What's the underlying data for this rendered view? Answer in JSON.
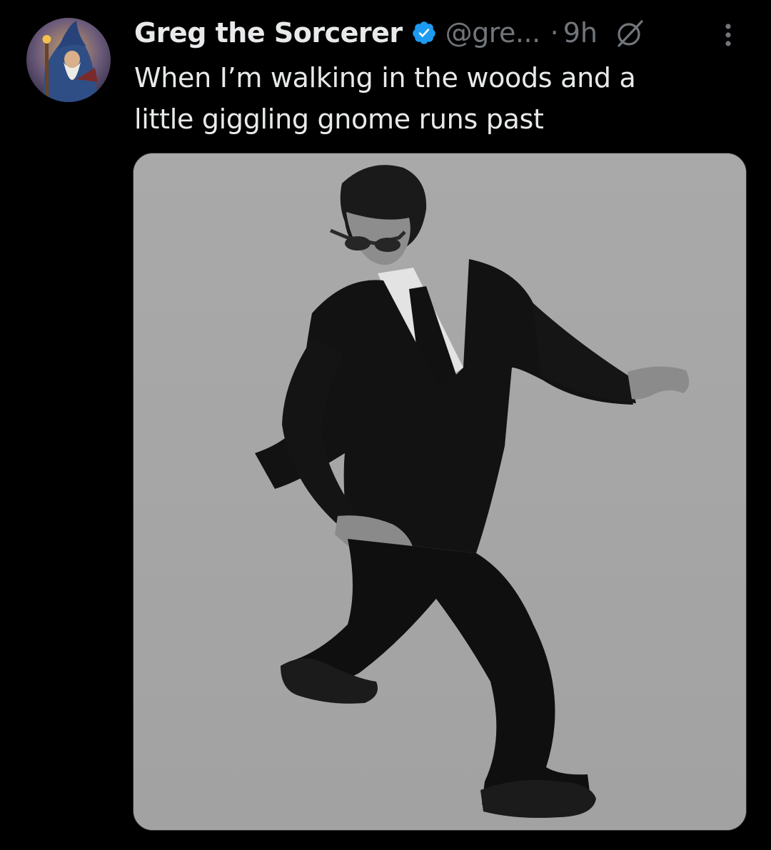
{
  "tweet": {
    "author": {
      "display_name": "Greg the Sorcerer",
      "handle": "@gre...",
      "verified": true,
      "verified_color": "#1d9bf0"
    },
    "separator": "·",
    "timestamp": "9h",
    "text_lines": [
      "When I’m walking in the woods and a",
      "little giggling gnome runs past"
    ],
    "icons": {
      "avatar": "wizard-avatar",
      "badge": "verified-badge-icon",
      "grok": "grok-icon",
      "more": "more-options-icon"
    }
  },
  "theme": {
    "background": "#000000",
    "text_primary": "#e7e9ea",
    "text_secondary": "#71767b"
  }
}
